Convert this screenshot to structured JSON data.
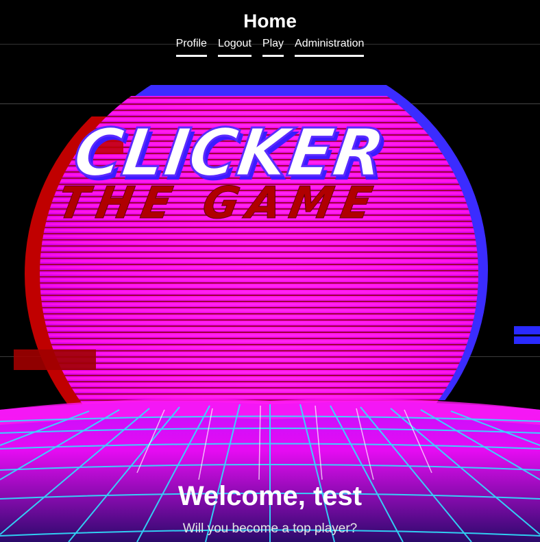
{
  "header": {
    "title": "Home",
    "nav": [
      {
        "label": "Profile"
      },
      {
        "label": "Logout"
      },
      {
        "label": "Play"
      },
      {
        "label": "Administration"
      }
    ]
  },
  "logo": {
    "line1": "CLICKER",
    "line2": "THE GAME"
  },
  "welcome": {
    "title": "Welcome, test",
    "subtitle": "Will you become a top player?"
  },
  "colors": {
    "background": "#000000",
    "sun": "#ff10f0",
    "grid": "#33e6ff",
    "glitch_red": "#d40000",
    "glitch_blue": "#2a2aff"
  }
}
